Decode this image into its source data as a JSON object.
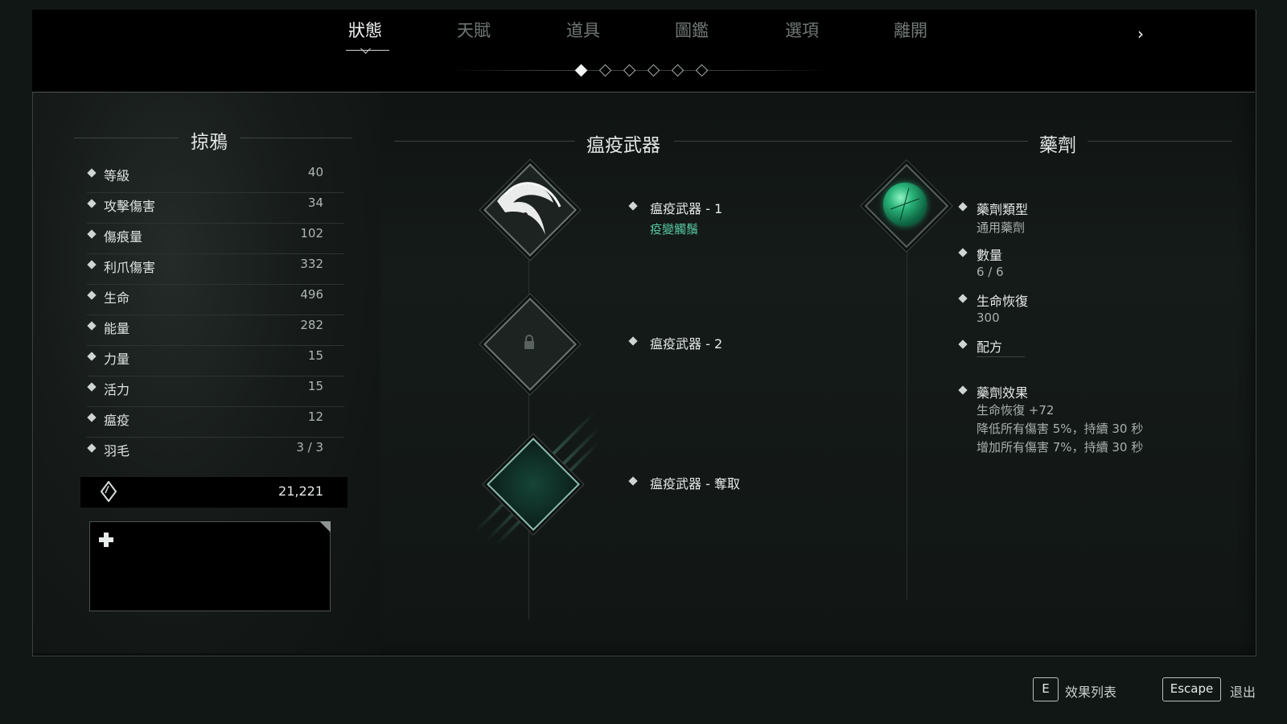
{
  "tabs": [
    {
      "label": "狀態",
      "active": true
    },
    {
      "label": "天賦",
      "active": false
    },
    {
      "label": "道具",
      "active": false
    },
    {
      "label": "圖鑑",
      "active": false
    },
    {
      "label": "選項",
      "active": false
    },
    {
      "label": "離開",
      "active": false
    }
  ],
  "page_indicator": {
    "count": 6,
    "current": 1
  },
  "character": {
    "title": "掠鴉",
    "stats": [
      {
        "label": "等級",
        "value": "40"
      },
      {
        "label": "攻擊傷害",
        "value": "34"
      },
      {
        "label": "傷痕量",
        "value": "102"
      },
      {
        "label": "利爪傷害",
        "value": "332"
      },
      {
        "label": "生命",
        "value": "496"
      },
      {
        "label": "能量",
        "value": "282"
      },
      {
        "label": "力量",
        "value": "15"
      },
      {
        "label": "活力",
        "value": "15"
      },
      {
        "label": "瘟疫",
        "value": "12"
      },
      {
        "label": "羽毛",
        "value": "3 / 3"
      }
    ],
    "currency": "21,221"
  },
  "plague_weapons": {
    "title": "瘟疫武器",
    "entries": [
      {
        "label": "瘟疫武器 - 1",
        "sub": "疫變觸鬚",
        "icon": "tentacle-icon"
      },
      {
        "label": "瘟疫武器 - 2",
        "sub": "",
        "icon": "lock-icon"
      },
      {
        "label": "瘟疫武器 - 奪取",
        "sub": "",
        "icon": "empty-green-slot"
      }
    ]
  },
  "potion": {
    "title": "藥劑",
    "icon": "green-potion-orb-icon",
    "type_label": "藥劑類型",
    "type_value": "通用藥劑",
    "quantity_label": "數量",
    "quantity_value": "6 / 6",
    "heal_label": "生命恢復",
    "heal_value": "300",
    "recipe_label": "配方",
    "effect_label": "藥劑效果",
    "effects": [
      "生命恢復 +72",
      "降低所有傷害 5%，持續 30 秒",
      "增加所有傷害 7%，持續 30 秒"
    ]
  },
  "hints": {
    "effects_key": "E",
    "effects_label": "效果列表",
    "exit_key": "Escape",
    "exit_label": "退出"
  },
  "colors": {
    "accent_green": "#57c6a1",
    "background": "#111715"
  }
}
